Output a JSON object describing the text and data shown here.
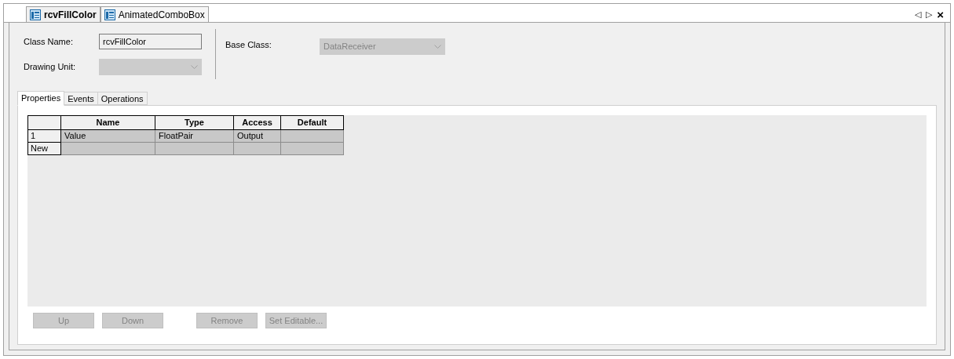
{
  "doc_tabs": [
    {
      "label": "rcvFillColor",
      "selected": true
    },
    {
      "label": "AnimatedComboBox",
      "selected": false
    }
  ],
  "nav": {
    "prev": "◁",
    "next": "▷",
    "close": "×"
  },
  "class_name": {
    "label": "Class Name:",
    "value": "rcvFillColor"
  },
  "drawing_unit": {
    "label": "Drawing Unit:",
    "disabled": true
  },
  "base_class": {
    "label": "Base Class:",
    "value": "DataReceiver",
    "disabled": true
  },
  "tabs": [
    {
      "label": "Properties",
      "selected": true
    },
    {
      "label": "Events",
      "selected": false
    },
    {
      "label": "Operations",
      "selected": false
    }
  ],
  "table": {
    "columns": [
      "Name",
      "Type",
      "Access",
      "Default"
    ],
    "rows": [
      {
        "header": "1",
        "cells": [
          "Value",
          "FloatPair",
          "Output",
          ""
        ]
      },
      {
        "header": "New",
        "cells": [
          "",
          "",
          "",
          ""
        ]
      }
    ]
  },
  "buttons": [
    {
      "label": "Up",
      "disabled": true
    },
    {
      "label": "Down",
      "disabled": true
    },
    {
      "label": "Remove",
      "disabled": true
    },
    {
      "label": "Set Editable...",
      "disabled": true
    }
  ]
}
